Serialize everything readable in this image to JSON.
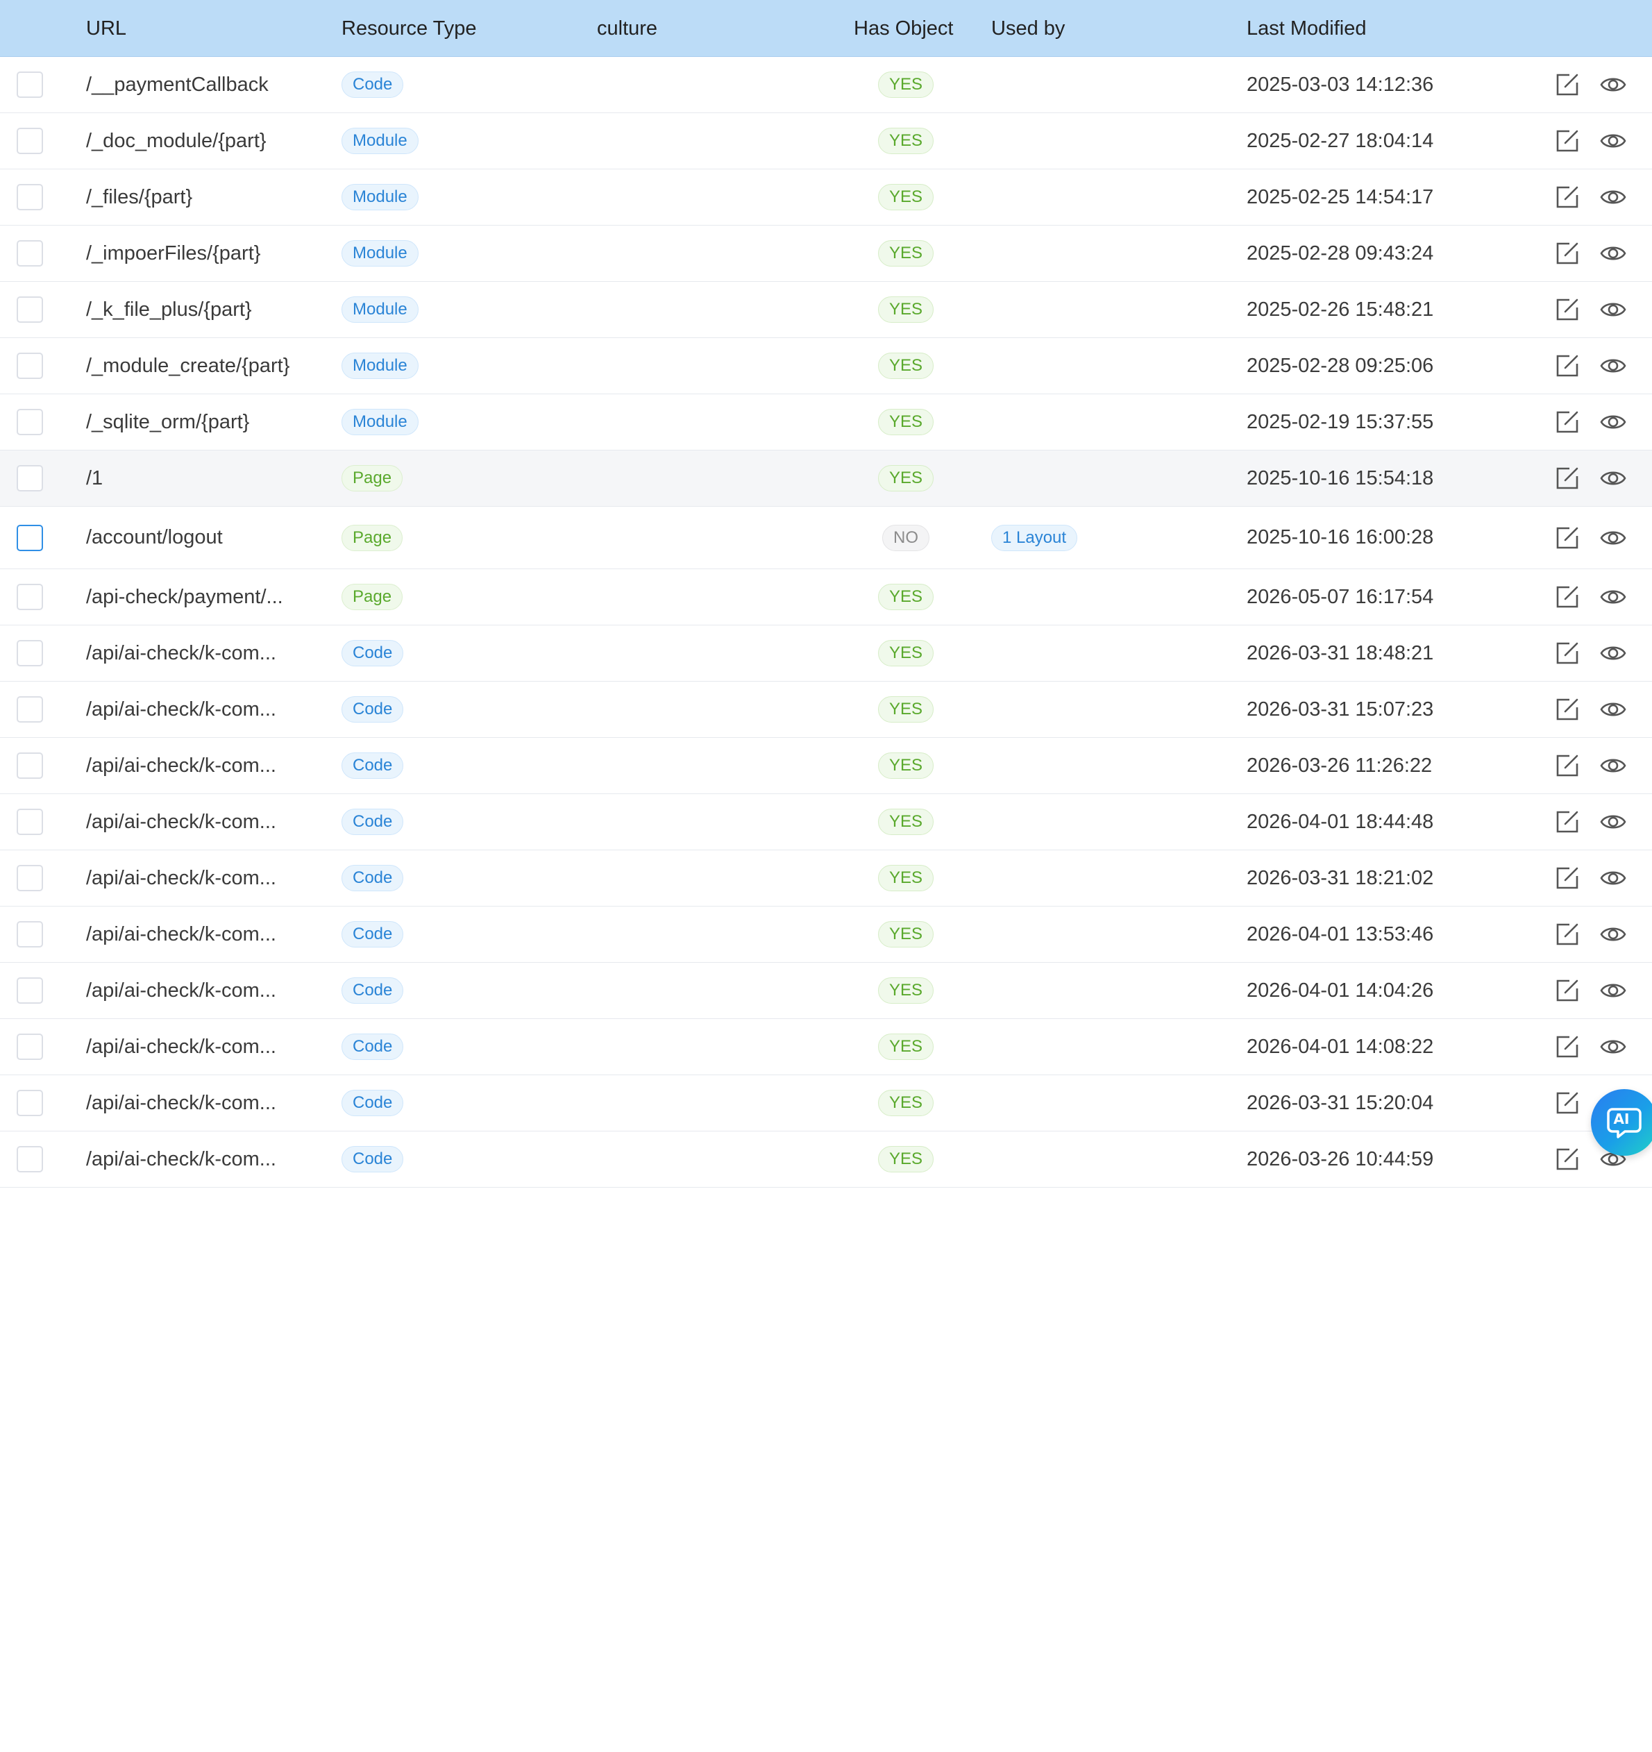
{
  "headers": {
    "url": "URL",
    "resource_type": "Resource Type",
    "culture": "culture",
    "has_object": "Has Object",
    "used_by": "Used by",
    "last_modified": "Last Modified"
  },
  "rows": [
    {
      "url": "/__paymentCallback",
      "type": "Code",
      "has_object": "YES",
      "used_by": "",
      "modified": "2025-03-03 14:12:36"
    },
    {
      "url": "/_doc_module/{part}",
      "type": "Module",
      "has_object": "YES",
      "used_by": "",
      "modified": "2025-02-27 18:04:14"
    },
    {
      "url": "/_files/{part}",
      "type": "Module",
      "has_object": "YES",
      "used_by": "",
      "modified": "2025-02-25 14:54:17"
    },
    {
      "url": "/_impoerFiles/{part}",
      "type": "Module",
      "has_object": "YES",
      "used_by": "",
      "modified": "2025-02-28 09:43:24"
    },
    {
      "url": "/_k_file_plus/{part}",
      "type": "Module",
      "has_object": "YES",
      "used_by": "",
      "modified": "2025-02-26 15:48:21"
    },
    {
      "url": "/_module_create/{part}",
      "type": "Module",
      "has_object": "YES",
      "used_by": "",
      "modified": "2025-02-28 09:25:06"
    },
    {
      "url": "/_sqlite_orm/{part}",
      "type": "Module",
      "has_object": "YES",
      "used_by": "",
      "modified": "2025-02-19 15:37:55"
    },
    {
      "url": "/1",
      "type": "Page",
      "has_object": "YES",
      "used_by": "",
      "modified": "2025-10-16 15:54:18"
    },
    {
      "url": "/account/logout",
      "type": "Page",
      "has_object": "NO",
      "used_by": "1 Layout",
      "modified": "2025-10-16 16:00:28"
    },
    {
      "url": "/api-check/payment/...",
      "type": "Page",
      "has_object": "YES",
      "used_by": "",
      "modified": "2026-05-07 16:17:54"
    },
    {
      "url": "/api/ai-check/k-com...",
      "type": "Code",
      "has_object": "YES",
      "used_by": "",
      "modified": "2026-03-31 18:48:21"
    },
    {
      "url": "/api/ai-check/k-com...",
      "type": "Code",
      "has_object": "YES",
      "used_by": "",
      "modified": "2026-03-31 15:07:23"
    },
    {
      "url": "/api/ai-check/k-com...",
      "type": "Code",
      "has_object": "YES",
      "used_by": "",
      "modified": "2026-03-26 11:26:22"
    },
    {
      "url": "/api/ai-check/k-com...",
      "type": "Code",
      "has_object": "YES",
      "used_by": "",
      "modified": "2026-04-01 18:44:48"
    },
    {
      "url": "/api/ai-check/k-com...",
      "type": "Code",
      "has_object": "YES",
      "used_by": "",
      "modified": "2026-03-31 18:21:02"
    },
    {
      "url": "/api/ai-check/k-com...",
      "type": "Code",
      "has_object": "YES",
      "used_by": "",
      "modified": "2026-04-01 13:53:46"
    },
    {
      "url": "/api/ai-check/k-com...",
      "type": "Code",
      "has_object": "YES",
      "used_by": "",
      "modified": "2026-04-01 14:04:26"
    },
    {
      "url": "/api/ai-check/k-com...",
      "type": "Code",
      "has_object": "YES",
      "used_by": "",
      "modified": "2026-04-01 14:08:22"
    },
    {
      "url": "/api/ai-check/k-com...",
      "type": "Code",
      "has_object": "YES",
      "used_by": "",
      "modified": "2026-03-31 15:20:04"
    },
    {
      "url": "/api/ai-check/k-com...",
      "type": "Code",
      "has_object": "YES",
      "used_by": "",
      "modified": "2026-03-26 10:44:59"
    }
  ],
  "ai_button": {
    "label": "AI"
  },
  "icons": {
    "edit": "edit-icon",
    "view": "eye-icon"
  },
  "colors": {
    "header_bg": "#bcdcf7",
    "code_module_tag": "#2a84d6",
    "page_yes_tag": "#5aa92d",
    "no_tag": "#8c8c8c",
    "checkbox_active": "#2f8fe6"
  }
}
